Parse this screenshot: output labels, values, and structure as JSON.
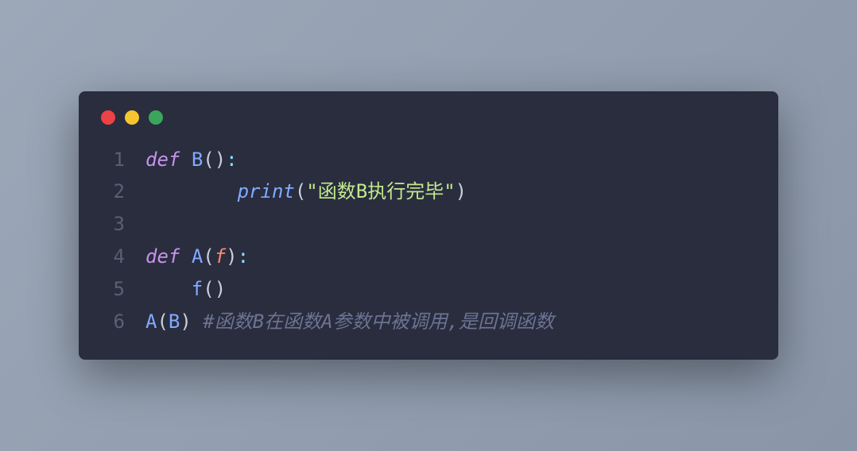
{
  "window": {
    "controls": [
      "close",
      "minimize",
      "maximize"
    ]
  },
  "code": {
    "lines": [
      {
        "num": "1",
        "tokens": {
          "keyword": "def",
          "space1": " ",
          "funcname": "B",
          "paren_open": "(",
          "paren_close": ")",
          "colon": ":"
        }
      },
      {
        "num": "2",
        "tokens": {
          "indent": "        ",
          "builtin": "print",
          "paren_open": "(",
          "string": "\"函数B执行完毕\"",
          "paren_close": ")"
        }
      },
      {
        "num": "3",
        "tokens": {}
      },
      {
        "num": "4",
        "tokens": {
          "keyword": "def",
          "space1": " ",
          "funcname": "A",
          "paren_open": "(",
          "param": "f",
          "paren_close": ")",
          "colon": ":"
        }
      },
      {
        "num": "5",
        "tokens": {
          "indent": "    ",
          "call": "f",
          "paren_open": "(",
          "paren_close": ")"
        }
      },
      {
        "num": "6",
        "tokens": {
          "call": "A",
          "paren_open": "(",
          "arg": "B",
          "paren_close": ")",
          "space": " ",
          "comment": "#函数B在函数A参数中被调用,是回调函数"
        }
      }
    ]
  }
}
